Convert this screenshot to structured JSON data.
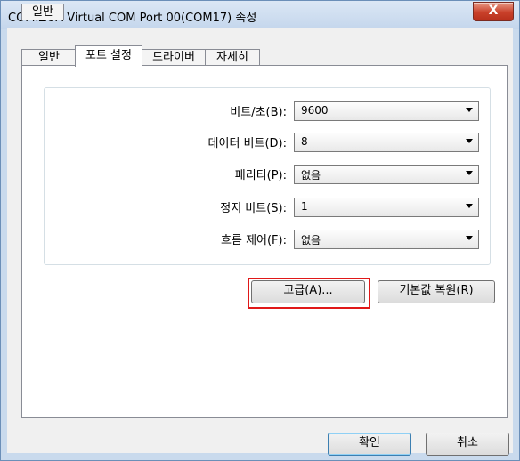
{
  "window": {
    "title": "COMIZOA Virtual COM Port 00(COM17) 속성",
    "close_glyph": "X"
  },
  "tabs": [
    {
      "label": "일반"
    },
    {
      "label": "포트 설정"
    },
    {
      "label": "드라이버"
    },
    {
      "label": "자세히"
    }
  ],
  "settings": [
    {
      "label": "비트/초(B):",
      "value": "9600"
    },
    {
      "label": "데이터 비트(D):",
      "value": "8"
    },
    {
      "label": "패리티(P):",
      "value": "없음"
    },
    {
      "label": "정지 비트(S):",
      "value": "1"
    },
    {
      "label": "흐름 제어(F):",
      "value": "없음"
    }
  ],
  "buttons": {
    "advanced": "고급(A)...",
    "restore_defaults": "기본값 복원(R)",
    "ok": "확인",
    "cancel": "취소"
  },
  "colors": {
    "highlight_box": "#e01818",
    "close_button": "#c9402a"
  }
}
